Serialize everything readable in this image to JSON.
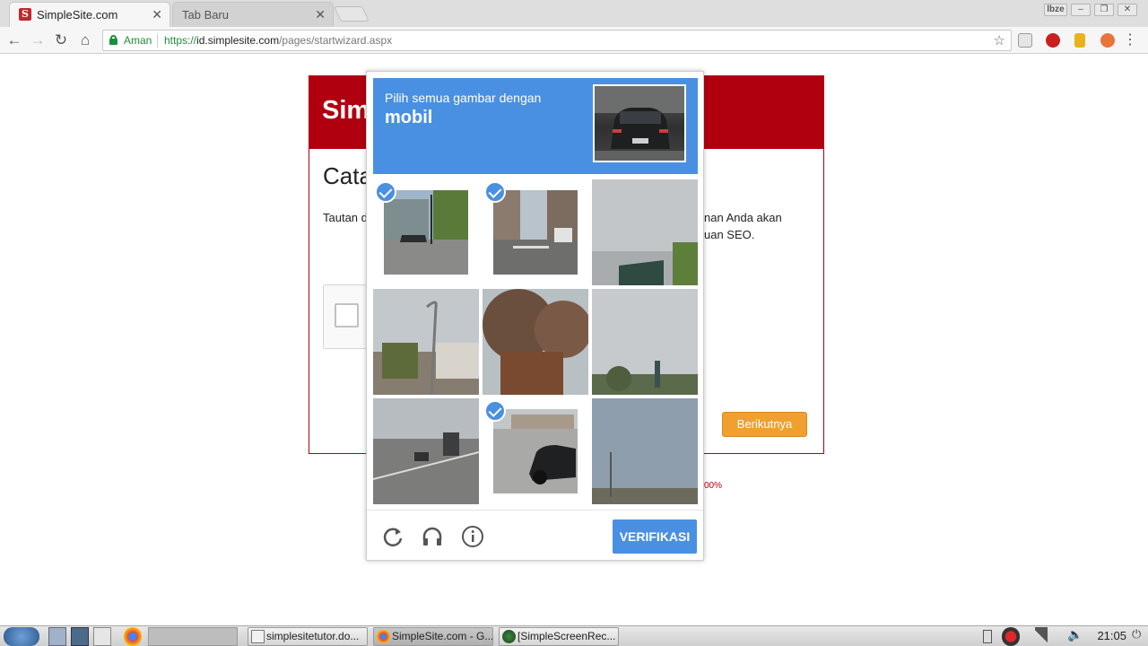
{
  "browser": {
    "tabs": [
      {
        "title": "SimpleSite.com",
        "favicon": "S",
        "active": true
      },
      {
        "title": "Tab Baru",
        "active": false
      }
    ],
    "user_badge": "lbze",
    "address": {
      "secure_label": "Aman",
      "scheme": "https://",
      "host": "id.simplesite.com",
      "path": "/pages/startwizard.aspx"
    }
  },
  "wizard": {
    "brand": "SimpleSite",
    "heading": "Catatan",
    "desc_left": "Tautan dan bekerja",
    "desc_right": "nan Anda akan\nuan SEO.",
    "next_button": "Berikutnya",
    "progress_text": "00%"
  },
  "captcha": {
    "prompt": "Pilih semua gambar dengan",
    "target": "mobil",
    "tiles_selected": [
      true,
      true,
      false,
      false,
      false,
      false,
      false,
      true,
      false
    ],
    "verify_button": "VERIFIKASI",
    "colors": {
      "accent": "#4a90e2"
    }
  },
  "taskbar": {
    "tasks": [
      {
        "label": "simplesitetutor.do..."
      },
      {
        "label": "SimpleSite.com - G..."
      },
      {
        "label": "[SimpleScreenRec..."
      }
    ],
    "clock": "21:05"
  }
}
